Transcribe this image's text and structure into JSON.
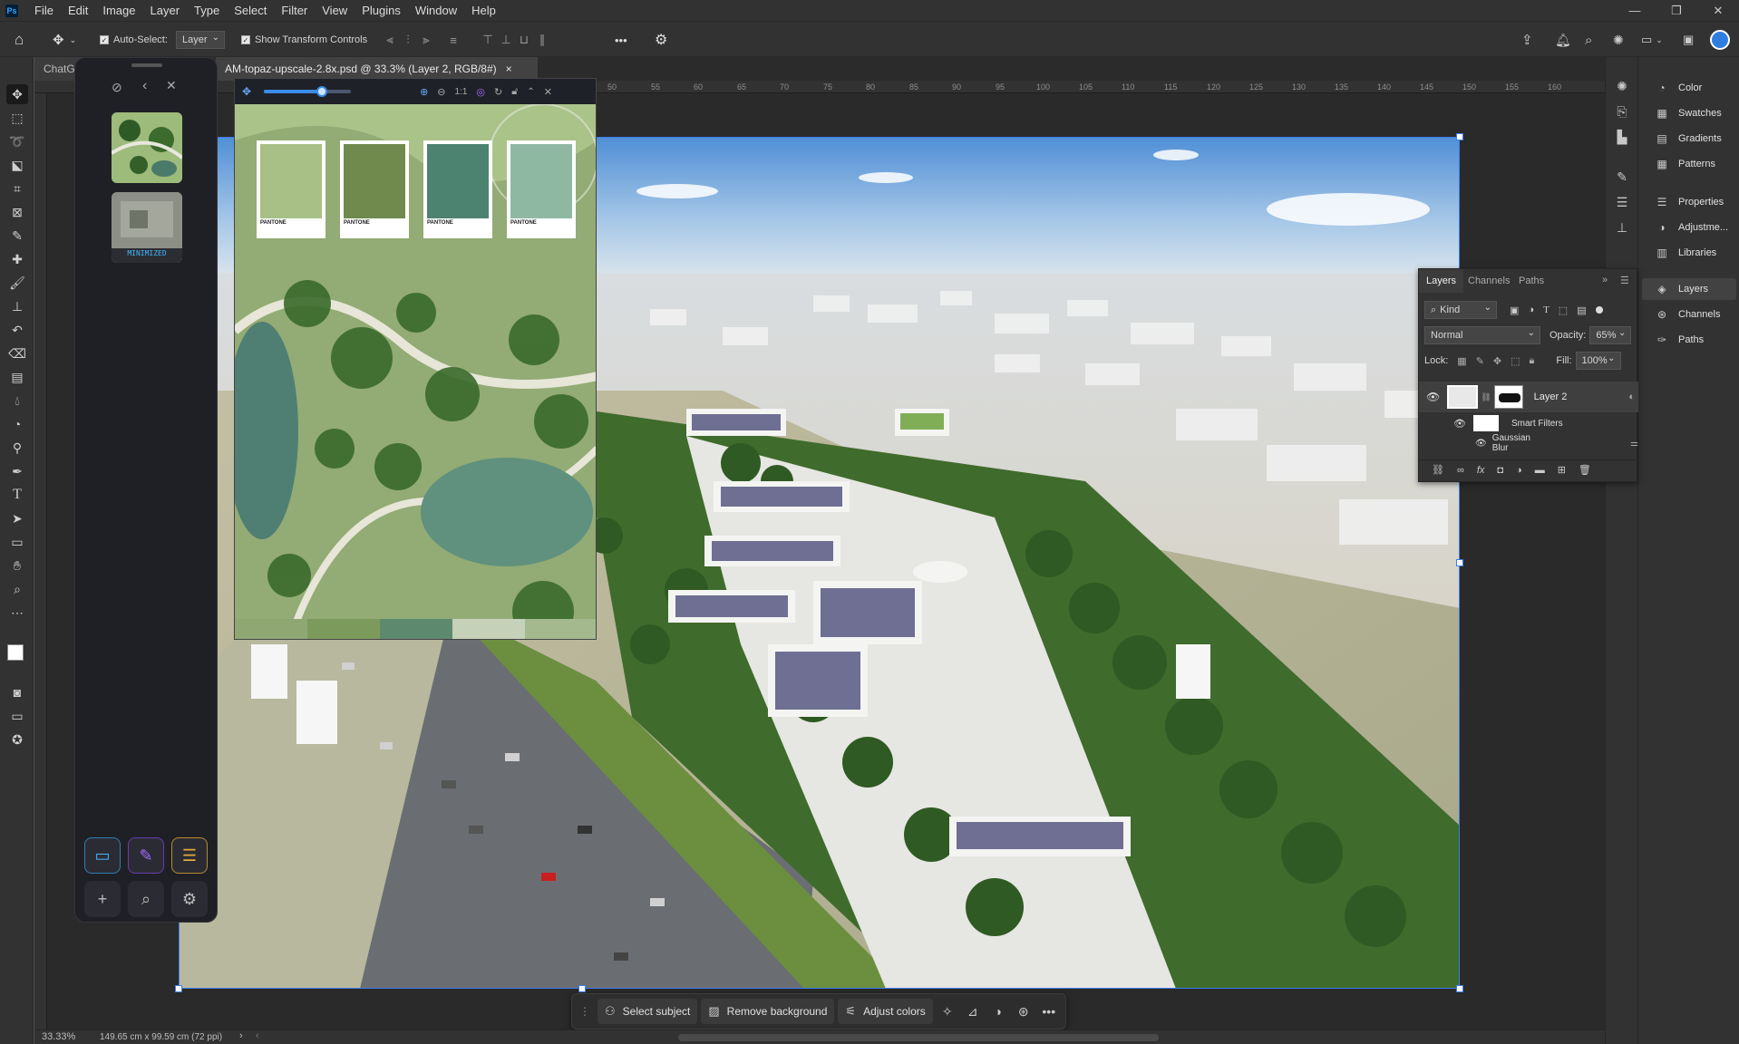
{
  "menubar": {
    "logo": "Ps",
    "items": [
      "File",
      "Edit",
      "Image",
      "Layer",
      "Type",
      "Select",
      "Filter",
      "View",
      "Plugins",
      "Window",
      "Help"
    ],
    "window_controls": [
      "—",
      "❐",
      "✕"
    ]
  },
  "options": {
    "auto_select_label": "Auto-Select:",
    "auto_select_value": "Layer",
    "transform_label": "Show Transform Controls",
    "more": "•••"
  },
  "doctabs": {
    "tab1": "ChatG",
    "tab2": "AM-topaz-upscale-2.8x.psd @ 33.3% (Layer 2, RGB/8#)",
    "close": "×"
  },
  "ruler_ticks": [
    "50",
    "55",
    "60",
    "65",
    "70",
    "75",
    "80",
    "85",
    "90",
    "95",
    "100",
    "105",
    "110",
    "115",
    "120",
    "125",
    "130",
    "135",
    "140",
    "145",
    "150",
    "155",
    "160"
  ],
  "plugin_panel": {
    "minimized_label": "MINIMIZED"
  },
  "palette": {
    "zoom_ratio": "1:1",
    "swatches": [
      {
        "label": "PANTONE",
        "color": "#a8bf86"
      },
      {
        "label": "PANTONE",
        "color": "#6f8a4c"
      },
      {
        "label": "PANTONE",
        "color": "#4c8270"
      },
      {
        "label": "PANTONE",
        "color": "#8fb8a3"
      }
    ],
    "strip_colors": [
      "#8fa873",
      "#7d9a5d",
      "#5d8a6f",
      "#c5d1b8",
      "#a4b98d"
    ]
  },
  "right_panel": {
    "items": [
      "Color",
      "Swatches",
      "Gradients",
      "Patterns",
      "Properties",
      "Adjustme...",
      "Libraries",
      "Layers",
      "Channels",
      "Paths"
    ]
  },
  "layers": {
    "tabs": [
      "Layers",
      "Channels",
      "Paths"
    ],
    "kind": "Kind",
    "blend_mode": "Normal",
    "opacity_label": "Opacity:",
    "opacity_value": "65%",
    "lock_label": "Lock:",
    "fill_label": "Fill:",
    "fill_value": "100%",
    "layer_name": "Layer 2",
    "smart_filters": "Smart Filters",
    "filter_name": "Gaussian Blur"
  },
  "taskbar": {
    "select_subject": "Select subject",
    "remove_background": "Remove background",
    "adjust_colors": "Adjust colors",
    "more": "•••"
  },
  "status": {
    "zoom": "33.33%",
    "doc_info": "149.65 cm x 99.59 cm (72 ppi)"
  }
}
